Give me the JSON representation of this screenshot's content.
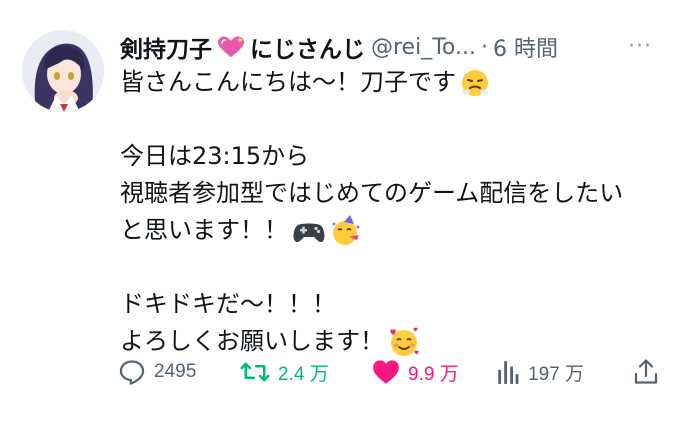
{
  "tweet": {
    "author": {
      "display_name": "剣持刀子",
      "affiliation": "にじさんじ",
      "handle": "@rei_To...",
      "name_emoji": "heart-with-sparkles"
    },
    "time_separator": "·",
    "time": "6 時間",
    "more_label": "···",
    "lines": [
      {
        "text": "皆さんこんにちは〜！刀子です",
        "emoji": "huffing-face"
      },
      {
        "text": "",
        "emoji": ""
      },
      {
        "text": "今日は23:15から",
        "emoji": ""
      },
      {
        "text": "視聴者参加型ではじめてのゲーム配信をしたい",
        "emoji": ""
      },
      {
        "text": "と思います！！",
        "emoji": "game-controller, party-face"
      },
      {
        "text": "",
        "emoji": ""
      },
      {
        "text": "ドキドキだ〜！！！",
        "emoji": ""
      },
      {
        "text": "よろしくお願いします！",
        "emoji": "smiling-face-with-hearts"
      }
    ],
    "actions": {
      "replies": "2495",
      "retweets": "2.4 万",
      "likes": "9.9 万",
      "views": "197 万"
    }
  },
  "colors": {
    "text": "#0f1419",
    "muted": "#536471",
    "retweet": "#00ba7c",
    "like": "#f91880",
    "name_heart": "#e85aa8"
  }
}
